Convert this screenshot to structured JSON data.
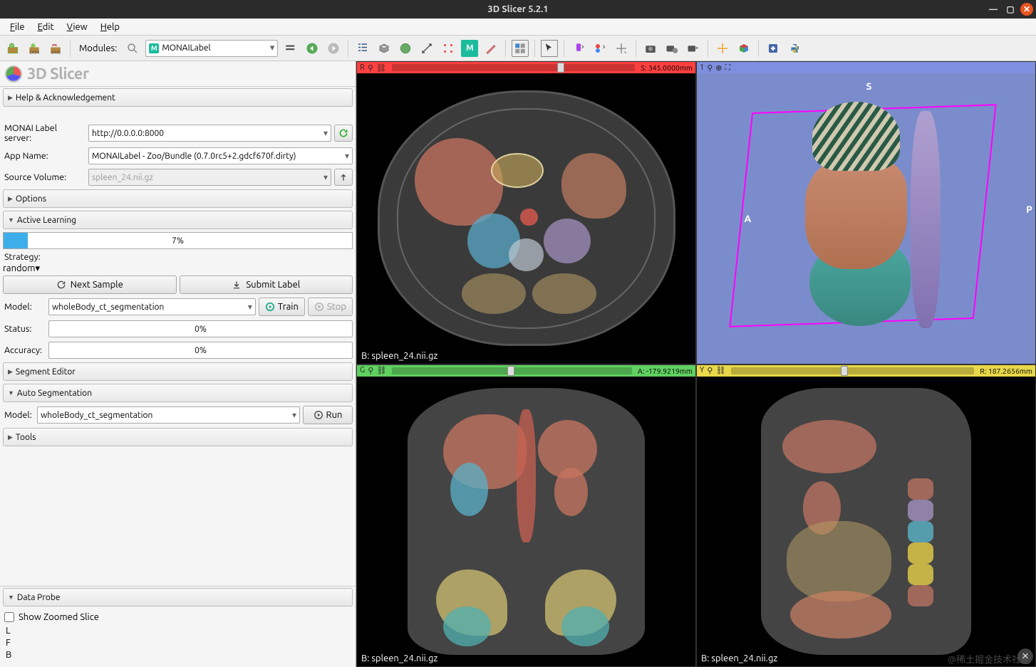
{
  "title": "3D Slicer 5.2.1",
  "menu": {
    "file": "File",
    "edit": "Edit",
    "view": "View",
    "help": "Help"
  },
  "toolbar": {
    "data": "DATA",
    "dcm": "DCM",
    "save": "SAVE",
    "modules_label": "Modules:",
    "module_selected": "MONAILabel"
  },
  "app": {
    "title": "3D Slicer"
  },
  "sections": {
    "help": "Help & Acknowledgement",
    "options": "Options",
    "active_learning": "Active Learning",
    "segment_editor": "Segment Editor",
    "auto_seg": "Auto Segmentation",
    "tools": "Tools",
    "data_probe": "Data Probe"
  },
  "server": {
    "label": "MONAI Label server:",
    "value": "http://0.0.0.0:8000"
  },
  "app_name": {
    "label": "App Name:",
    "value": "MONAILabel - Zoo/Bundle (0.7.0rc5+2.gdcf670f.dirty)"
  },
  "source_volume": {
    "label": "Source Volume:",
    "value": "spleen_24.nii.gz"
  },
  "active_learning": {
    "progress_pct": "7%",
    "progress_width": "7%",
    "strategy_label": "Strategy:",
    "strategy_value": "random",
    "next_sample": "Next Sample",
    "submit_label": "Submit Label",
    "model_label": "Model:",
    "model_value": "wholeBody_ct_segmentation",
    "train": "Train",
    "stop": "Stop",
    "status_label": "Status:",
    "status_value": "0%",
    "accuracy_label": "Accuracy:",
    "accuracy_value": "0%"
  },
  "auto_seg": {
    "model_label": "Model:",
    "model_value": "wholeBody_ct_segmentation",
    "run": "Run"
  },
  "data_probe": {
    "show_zoomed": "Show Zoomed Slice",
    "L": "L",
    "F": "F",
    "B": "B"
  },
  "viewers": {
    "red": {
      "tag": "R",
      "value": "S: 345.0000mm",
      "label": "B: spleen_24.nii.gz",
      "thumb": "68%"
    },
    "green": {
      "tag": "G",
      "value": "A: -179.9219mm",
      "label": "B: spleen_24.nii.gz",
      "thumb": "48%"
    },
    "yellow": {
      "tag": "Y",
      "value": "R: 187.2656mm",
      "label": "B: spleen_24.nii.gz",
      "thumb": "45%"
    },
    "threeD": {
      "tag": "1",
      "S": "S",
      "A": "A",
      "P": "P"
    }
  },
  "watermark": "@稀土掘金技术社区"
}
